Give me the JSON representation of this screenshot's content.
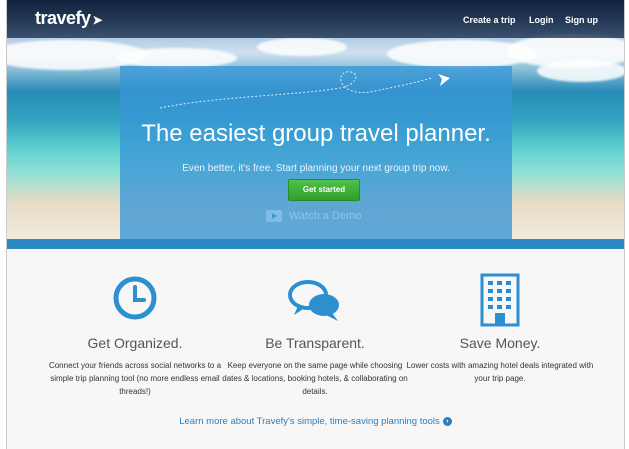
{
  "brand": {
    "logo": "travefy"
  },
  "nav": {
    "create_trip": "Create a trip",
    "login": "Login",
    "signup": "Sign up"
  },
  "hero": {
    "headline": "The easiest group travel planner.",
    "subheadline": "Even better, it's free. Start planning your next group trip now.",
    "cta_label": "Get started",
    "demo_label": "Watch a Demo"
  },
  "features": [
    {
      "title": "Get Organized.",
      "desc": "Connect your friends across social networks to a simple trip planning tool (no more endless email threads!)",
      "icon": "clock-icon"
    },
    {
      "title": "Be Transparent.",
      "desc": "Keep everyone on the same page while choosing dates & locations, booking hotels, & collaborating on details.",
      "icon": "chat-bubbles-icon"
    },
    {
      "title": "Save Money.",
      "desc": "Lower costs with amazing hotel deals integrated with your trip page.",
      "icon": "building-icon"
    }
  ],
  "learn_more": "Learn more about Travefy's simple, time-saving planning tools",
  "colors": {
    "accent": "#2b89c4",
    "panel": "#3996d6",
    "cta": "#3aa83a"
  }
}
